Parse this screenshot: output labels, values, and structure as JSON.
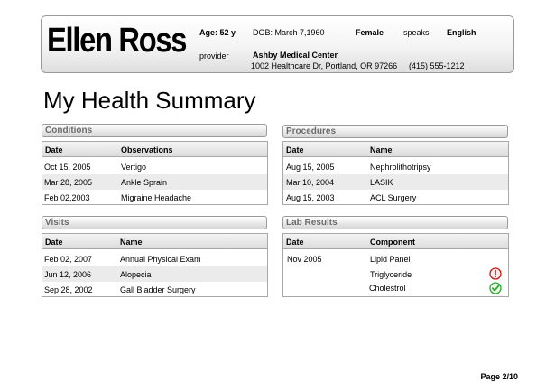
{
  "header": {
    "patient_name": "Ellen Ross",
    "age": "Age: 52 y",
    "dob": "DOB: March 7,1960",
    "gender": "Female",
    "speaks_label": "speaks",
    "language": "English",
    "provider_label": "provider",
    "provider_name": "Ashby Medical Center",
    "provider_address": "1002 Healthcare Dr, Portland, OR 97266",
    "provider_phone": "(415) 555-1212"
  },
  "page_title": "My Health Summary",
  "conditions": {
    "title": "Conditions",
    "columns": [
      "Date",
      "Observations"
    ],
    "rows": [
      [
        "Oct 15, 2005",
        "Vertigo"
      ],
      [
        "Mar 28, 2005",
        "Ankle Sprain"
      ],
      [
        "Feb 02,2003",
        "Migraine Headache"
      ]
    ]
  },
  "procedures": {
    "title": "Procedures",
    "columns": [
      "Date",
      "Name"
    ],
    "rows": [
      [
        "Aug 15, 2005",
        "Nephrolithotripsy"
      ],
      [
        "Mar 10, 2004",
        "LASIK"
      ],
      [
        "Aug 15, 2003",
        "ACL Surgery"
      ]
    ]
  },
  "visits": {
    "title": "Visits",
    "columns": [
      "Date",
      "Name"
    ],
    "rows": [
      [
        "Feb 02, 2007",
        "Annual Physical Exam"
      ],
      [
        "Jun 12, 2006",
        "Alopecia"
      ],
      [
        "Sep 28, 2002",
        "Gall Bladder Surgery"
      ]
    ]
  },
  "lab_results": {
    "title": "Lab Results",
    "columns": [
      "Date",
      "Component"
    ],
    "rows": [
      {
        "date": "Nov 2005",
        "component": "Lipid Panel",
        "status_icon": ""
      },
      {
        "date": "",
        "component": "Triglyceride",
        "status_icon": "alert-icon"
      },
      {
        "date": "",
        "component": "Cholestrol",
        "status_icon": "check-icon"
      }
    ],
    "colors": {
      "alert": "#c81818",
      "ok": "#2fa52f"
    }
  },
  "footer": {
    "page": "Page 2/10"
  }
}
